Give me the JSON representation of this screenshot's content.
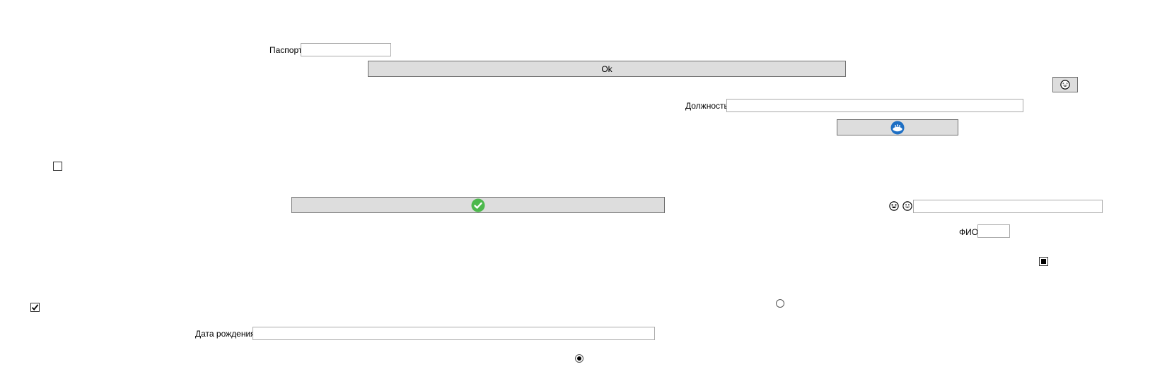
{
  "labels": {
    "passport": "Паспорт",
    "position": "Должность",
    "fio": "ФИО",
    "birth_date": "Дата рождения"
  },
  "inputs": {
    "passport_value": "",
    "position_value": "",
    "emoji_field_value": "",
    "fio_value": "",
    "birth_date_value": ""
  },
  "buttons": {
    "ok_label": "Ok"
  },
  "icons": {
    "smiley_button": "grinning-face-icon",
    "blue_button": "blue-badge-icon",
    "green_button": "green-check-icon",
    "emoji_left": "grinning-squint-face-icon",
    "emoji_right": "grinning-face-icon"
  },
  "checkboxes": {
    "top_left_checked": false,
    "bottom_left_checked": true,
    "right_indeterminate": true
  },
  "radios": {
    "right_selected": false,
    "bottom_selected": true
  },
  "colors": {
    "button_bg": "#dddddd",
    "button_border": "#707070",
    "input_border": "#a9a9a9",
    "blue_icon": "#1e6fc4",
    "green_icon": "#4cb84c"
  }
}
